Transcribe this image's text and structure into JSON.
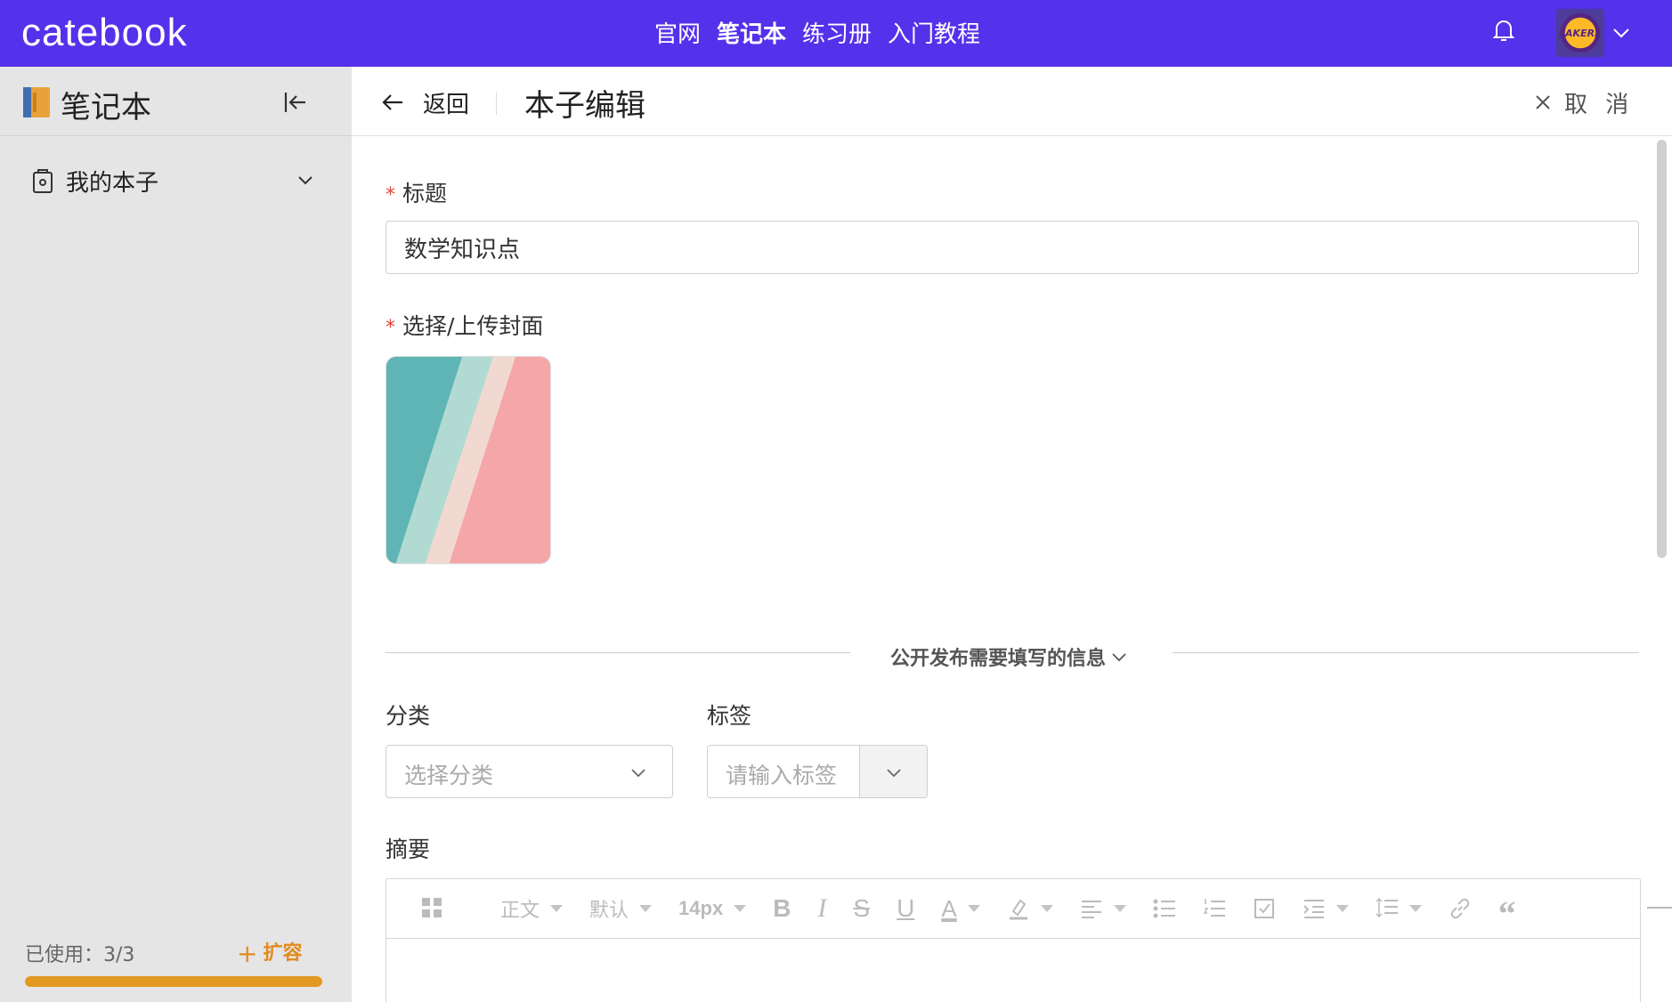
{
  "topbar": {
    "logo": "catebook",
    "nav": [
      "官网",
      "笔记本",
      "练习册",
      "入门教程"
    ],
    "active_nav": "笔记本",
    "accent": "#5431ea",
    "avatar_text": "LAKERS"
  },
  "sidebar": {
    "title": "笔记本",
    "item_label": "我的本子",
    "usage_label": "已使用：3/3",
    "expand_label": "扩容",
    "usage_fraction": 1.0
  },
  "header": {
    "back_label": "返回",
    "title": "本子编辑",
    "cancel_label": "取 消"
  },
  "form": {
    "title_label": "标题",
    "title_value": "数学知识点",
    "cover_label": "选择/上传封面",
    "divider_text": "公开发布需要填写的信息",
    "category_label": "分类",
    "category_placeholder": "选择分类",
    "tag_label": "标签",
    "tag_placeholder": "请输入标签",
    "summary_label": "摘要"
  },
  "toolbar": {
    "heading": "正文",
    "font": "默认",
    "size": "14px",
    "bold": "B",
    "italic": "I",
    "strike": "S",
    "underline": "U",
    "color": "A",
    "quote": "“"
  }
}
